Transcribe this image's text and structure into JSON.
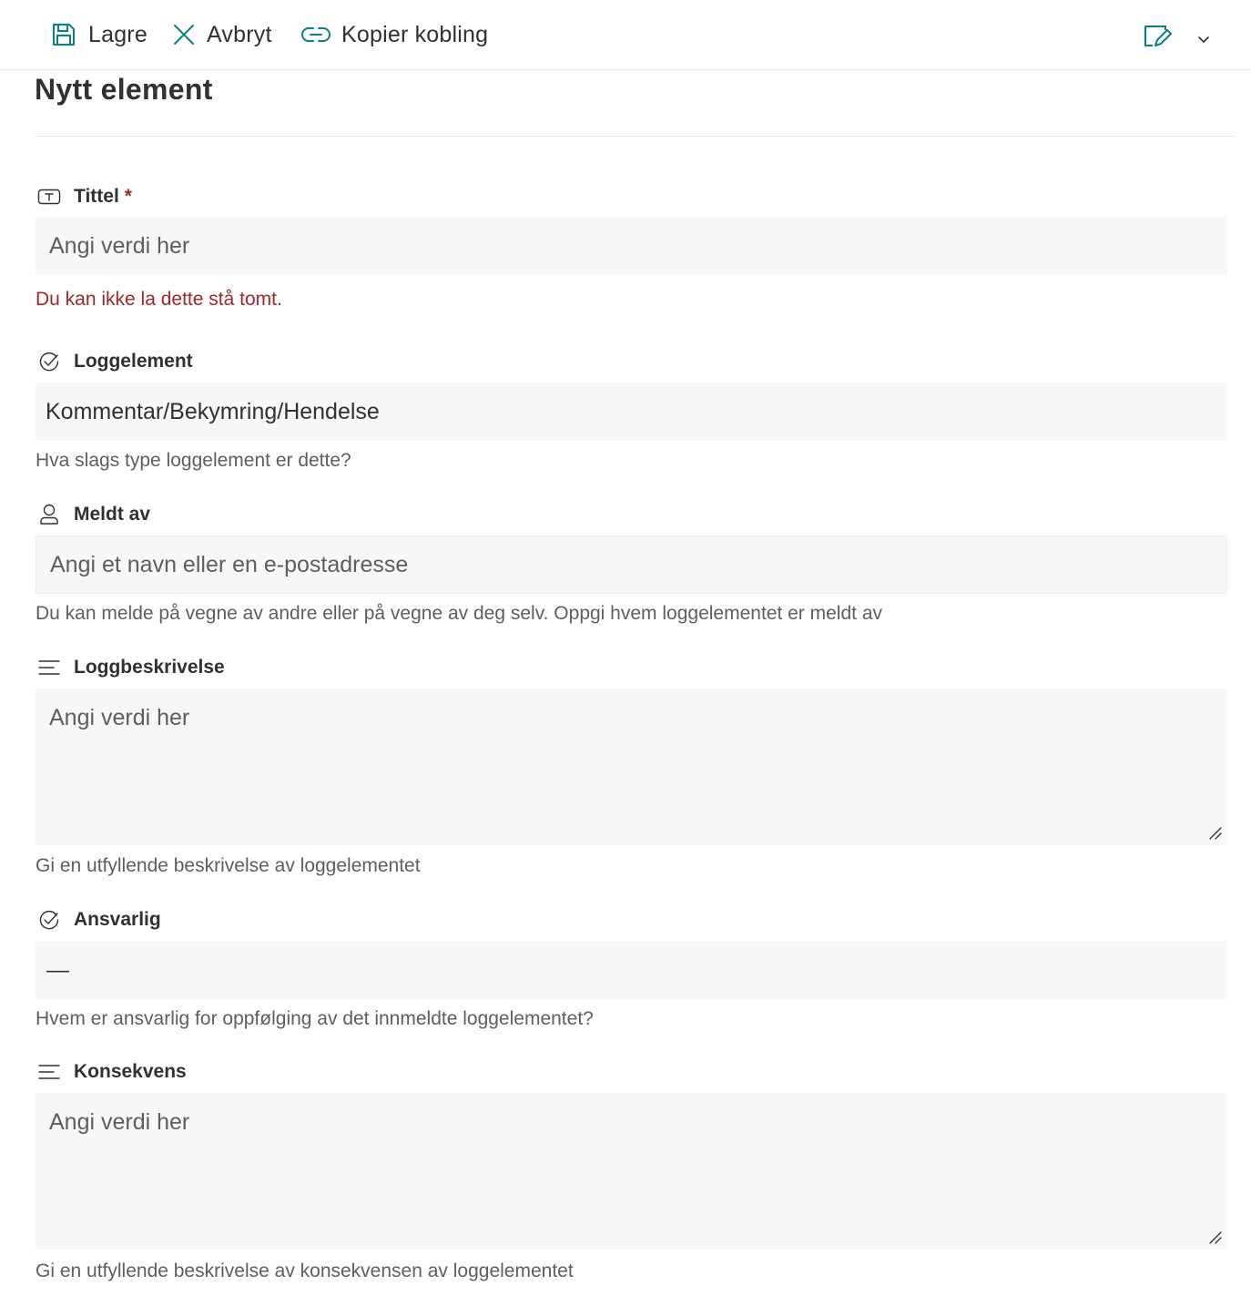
{
  "toolbar": {
    "save_label": "Lagre",
    "cancel_label": "Avbryt",
    "copy_link_label": "Kopier kobling"
  },
  "colors": {
    "accent": "#038387",
    "error": "#a4262c",
    "input_bg": "#f8f7f6"
  },
  "page": {
    "title": "Nytt element"
  },
  "fields": {
    "title": {
      "label": "Tittel",
      "required_mark": "*",
      "icon": "text-field-icon",
      "placeholder": "Angi verdi her",
      "error": "Du kan ikke la dette stå tomt."
    },
    "log_item": {
      "label": "Loggelement",
      "icon": "choice-check-icon",
      "value": "Kommentar/Bekymring/Hendelse",
      "help": "Hva slags type loggelement er dette?"
    },
    "reported_by": {
      "label": "Meldt av",
      "icon": "person-icon",
      "placeholder": "Angi et navn eller en e-postadresse",
      "help": "Du kan melde på vegne av andre eller på vegne av deg selv. Oppgi hvem loggelementet er meldt av"
    },
    "log_description": {
      "label": "Loggbeskrivelse",
      "icon": "multiline-text-icon",
      "placeholder": "Angi verdi her",
      "help": "Gi en utfyllende beskrivelse av loggelementet"
    },
    "responsible": {
      "label": "Ansvarlig",
      "icon": "choice-check-icon",
      "value": "—",
      "help": "Hvem er ansvarlig for oppfølging av det innmeldte loggelementet?"
    },
    "consequence": {
      "label": "Konsekvens",
      "icon": "multiline-text-icon",
      "placeholder": "Angi verdi her",
      "help": "Gi en utfyllende beskrivelse av konsekvensen av loggelementet"
    }
  }
}
